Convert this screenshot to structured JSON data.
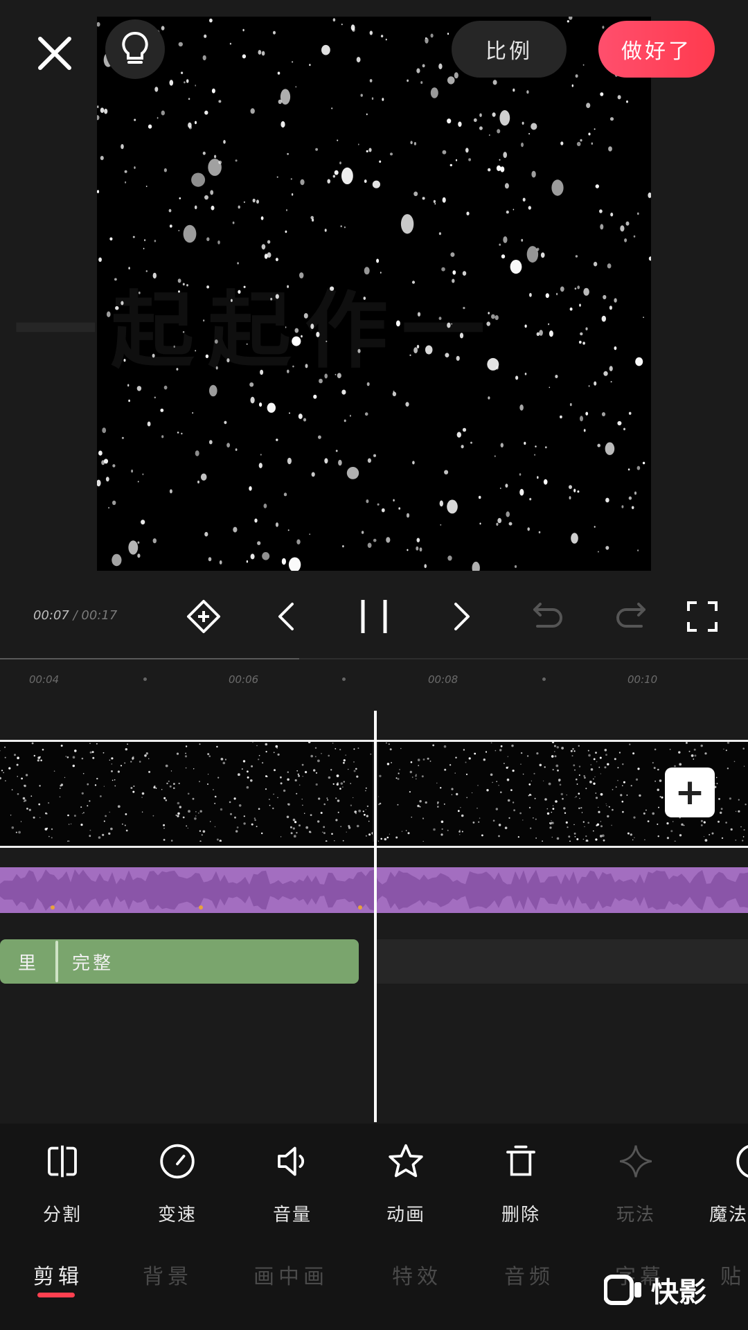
{
  "top_bar": {
    "ratio_label": "比例",
    "done_label": "做好了"
  },
  "preview": {
    "watermark": "一起起作一"
  },
  "playback": {
    "current_time": "00:07",
    "separator": "/",
    "total_time": "00:17",
    "progress": 0.4
  },
  "ruler": {
    "ticks": [
      "00:04",
      "00:06",
      "00:08",
      "00:10"
    ]
  },
  "subtitle_track": {
    "left_label": "里",
    "clip_text": "完整"
  },
  "toolbar": {
    "items": [
      {
        "label": "分割",
        "icon": "split-icon"
      },
      {
        "label": "变速",
        "icon": "speed-icon"
      },
      {
        "label": "音量",
        "icon": "volume-icon"
      },
      {
        "label": "动画",
        "icon": "star-icon"
      },
      {
        "label": "删除",
        "icon": "trash-icon"
      },
      {
        "label": "玩法",
        "icon": "sparkle-icon"
      },
      {
        "label": "魔法",
        "icon": "magic-icon"
      }
    ]
  },
  "tabs": [
    "剪辑",
    "背景",
    "画中画",
    "特效",
    "音频",
    "字幕",
    "贴"
  ],
  "active_tab": 0,
  "logo": {
    "text": "快影"
  },
  "colors": {
    "accent": "#ff4050",
    "done_button": "#ff4f6d",
    "audio_track": "#a36ec0",
    "subtitle_clip": "#7aa56d"
  }
}
